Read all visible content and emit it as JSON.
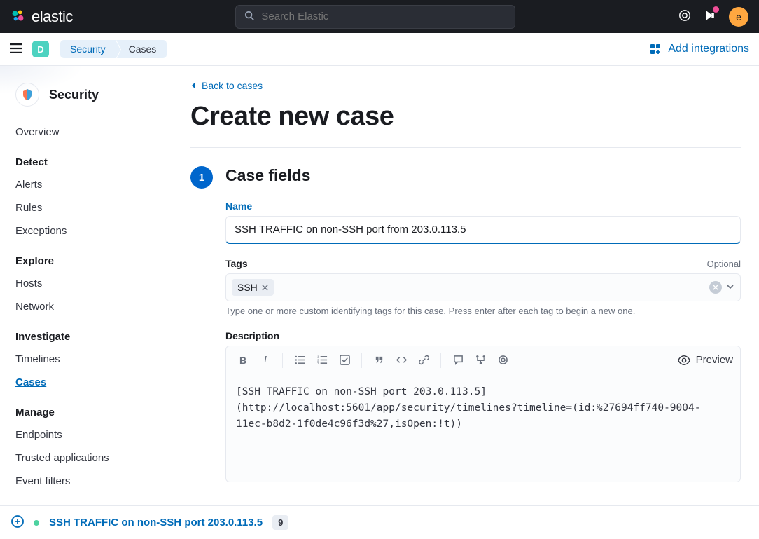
{
  "header": {
    "logo_text": "elastic",
    "search_placeholder": "Search Elastic",
    "avatar_letter": "e"
  },
  "subheader": {
    "space_letter": "D",
    "breadcrumbs": [
      "Security",
      "Cases"
    ],
    "add_integrations_label": "Add integrations"
  },
  "sidebar": {
    "app_title": "Security",
    "items": [
      {
        "type": "item",
        "label": "Overview",
        "active": false
      },
      {
        "type": "section",
        "label": "Detect"
      },
      {
        "type": "item",
        "label": "Alerts",
        "active": false
      },
      {
        "type": "item",
        "label": "Rules",
        "active": false
      },
      {
        "type": "item",
        "label": "Exceptions",
        "active": false
      },
      {
        "type": "section",
        "label": "Explore"
      },
      {
        "type": "item",
        "label": "Hosts",
        "active": false
      },
      {
        "type": "item",
        "label": "Network",
        "active": false
      },
      {
        "type": "section",
        "label": "Investigate"
      },
      {
        "type": "item",
        "label": "Timelines",
        "active": false
      },
      {
        "type": "item",
        "label": "Cases",
        "active": true
      },
      {
        "type": "section",
        "label": "Manage"
      },
      {
        "type": "item",
        "label": "Endpoints",
        "active": false
      },
      {
        "type": "item",
        "label": "Trusted applications",
        "active": false
      },
      {
        "type": "item",
        "label": "Event filters",
        "active": false
      }
    ]
  },
  "main": {
    "back_link": "Back to cases",
    "page_title": "Create new case",
    "step_number": "1",
    "step_title": "Case fields",
    "name_label": "Name",
    "name_value": "SSH TRAFFIC on non-SSH port from 203.0.113.5",
    "tags_label": "Tags",
    "tags_optional": "Optional",
    "tags": [
      "SSH"
    ],
    "tags_help": "Type one or more custom identifying tags for this case. Press enter after each tag to begin a new one.",
    "description_label": "Description",
    "preview_label": "Preview",
    "description_value": "[SSH TRAFFIC on non-SSH port 203.0.113.5](http://localhost:5601/app/security/timelines?timeline=(id:%27694ff740-9004-11ec-b8d2-1f0de4c96f3d%27,isOpen:!t))"
  },
  "timeline_bar": {
    "timeline_name": "SSH TRAFFIC on non-SSH port 203.0.113.5",
    "event_count": "9"
  }
}
